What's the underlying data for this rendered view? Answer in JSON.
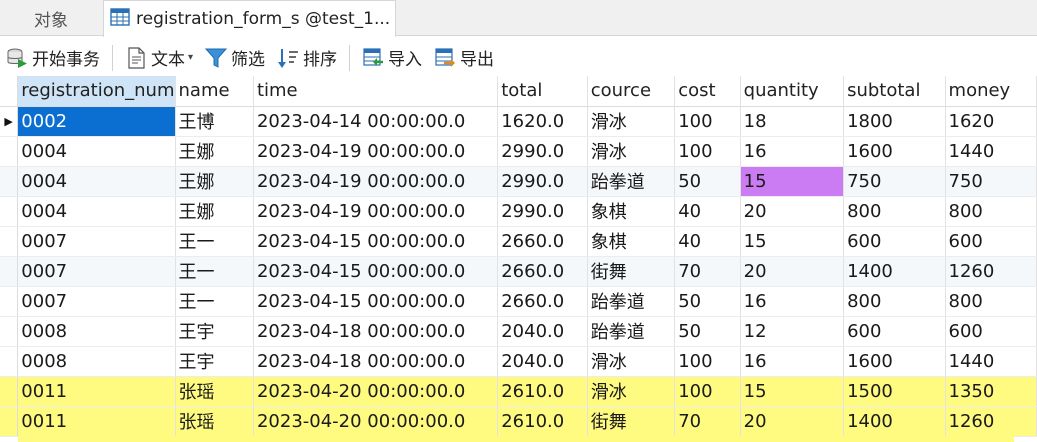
{
  "tabs": {
    "objects_label": "对象",
    "active_label": "registration_form_s @test_1..."
  },
  "toolbar": {
    "begin_transaction": "开始事务",
    "text": "文本",
    "filter": "筛选",
    "sort": "排序",
    "import": "导入",
    "export": "导出"
  },
  "grid": {
    "columns": [
      "registration_num",
      "name",
      "time",
      "total",
      "cource",
      "cost",
      "quantity",
      "subtotal",
      "money"
    ],
    "rows": [
      [
        "0002",
        "王博",
        "2023-04-14 00:00:00.0",
        "1620.0",
        "滑冰",
        "100",
        "18",
        "1800",
        "1620"
      ],
      [
        "0004",
        "王娜",
        "2023-04-19 00:00:00.0",
        "2990.0",
        "滑冰",
        "100",
        "16",
        "1600",
        "1440"
      ],
      [
        "0004",
        "王娜",
        "2023-04-19 00:00:00.0",
        "2990.0",
        "跆拳道",
        "50",
        "15",
        "750",
        "750"
      ],
      [
        "0004",
        "王娜",
        "2023-04-19 00:00:00.0",
        "2990.0",
        "象棋",
        "40",
        "20",
        "800",
        "800"
      ],
      [
        "0007",
        "王一",
        "2023-04-15 00:00:00.0",
        "2660.0",
        "象棋",
        "40",
        "15",
        "600",
        "600"
      ],
      [
        "0007",
        "王一",
        "2023-04-15 00:00:00.0",
        "2660.0",
        "街舞",
        "70",
        "20",
        "1400",
        "1260"
      ],
      [
        "0007",
        "王一",
        "2023-04-15 00:00:00.0",
        "2660.0",
        "跆拳道",
        "50",
        "16",
        "800",
        "800"
      ],
      [
        "0008",
        "王宇",
        "2023-04-18 00:00:00.0",
        "2040.0",
        "跆拳道",
        "50",
        "12",
        "600",
        "600"
      ],
      [
        "0008",
        "王宇",
        "2023-04-18 00:00:00.0",
        "2040.0",
        "滑冰",
        "100",
        "16",
        "1600",
        "1440"
      ],
      [
        "0011",
        "张瑶",
        "2023-04-20 00:00:00.0",
        "2610.0",
        "滑冰",
        "100",
        "15",
        "1500",
        "1350"
      ],
      [
        "0011",
        "张瑶",
        "2023-04-20 00:00:00.0",
        "2610.0",
        "街舞",
        "70",
        "20",
        "1400",
        "1260"
      ]
    ]
  },
  "colors": {
    "selected_cell": "#0a6fd0",
    "highlight_purple": "#cc7cf2",
    "highlight_yellow": "#fffb80",
    "selected_header": "#cfe5f7"
  }
}
